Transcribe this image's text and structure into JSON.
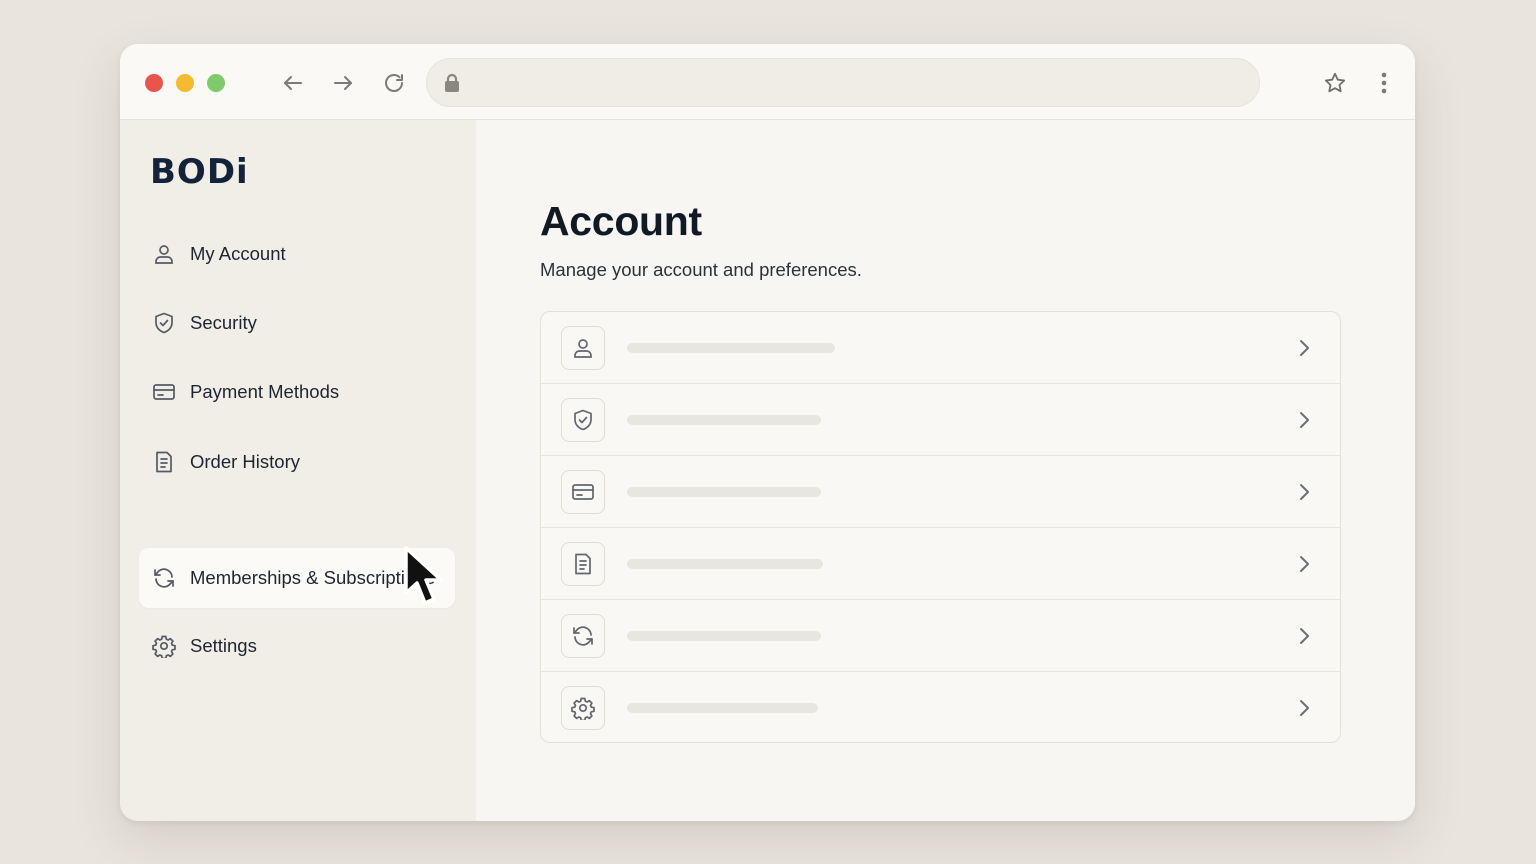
{
  "browser": {
    "address_value": "",
    "icons": [
      "back-arrow-icon",
      "forward-arrow-icon",
      "reload-icon",
      "lock-icon",
      "star-icon",
      "more-vert-icon"
    ]
  },
  "sidebar": {
    "logo": "BODi",
    "items": [
      {
        "label": "My Account",
        "icon": "user-icon",
        "active": false
      },
      {
        "label": "Security",
        "icon": "shield-icon",
        "active": false
      },
      {
        "label": "Payment Methods",
        "icon": "credit-card-icon",
        "active": false
      },
      {
        "label": "Order History",
        "icon": "receipt-icon",
        "active": false
      },
      {
        "label": "Memberships & Subscriptions",
        "icon": "refresh-icon",
        "active": true
      },
      {
        "label": "Settings",
        "icon": "gear-icon",
        "active": false
      }
    ]
  },
  "main": {
    "title": "Account",
    "subtitle": "Manage your account and preferences.",
    "rows": [
      {
        "icon": "user-icon"
      },
      {
        "icon": "shield-icon"
      },
      {
        "icon": "credit-card-icon"
      },
      {
        "icon": "receipt-icon"
      },
      {
        "icon": "refresh-icon"
      },
      {
        "icon": "gear-icon"
      }
    ]
  },
  "colors": {
    "background": "#e9e5dd",
    "sidebar": "#f1eee8",
    "logo": "#13233a",
    "text": "#1e2530",
    "close": "#e8554d",
    "minimize": "#f3bb2e",
    "maximize": "#7fcb6b"
  }
}
